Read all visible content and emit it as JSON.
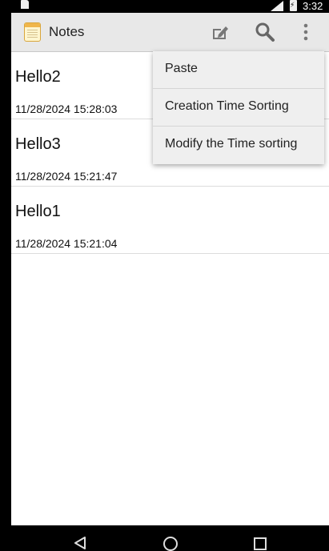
{
  "status_bar": {
    "time": "3:32"
  },
  "action_bar": {
    "title": "Notes",
    "icons": [
      "notepad-app-icon",
      "new-note-icon",
      "search-icon",
      "overflow-menu-icon"
    ]
  },
  "notes": [
    {
      "title": "Hello2",
      "time": "11/28/2024 15:28:03"
    },
    {
      "title": "Hello3",
      "time": "11/28/2024 15:21:47"
    },
    {
      "title": "Hello1",
      "time": "11/28/2024 15:21:04"
    }
  ],
  "menu": {
    "items": [
      {
        "label": "Paste"
      },
      {
        "label": "Creation Time Sorting"
      },
      {
        "label": "Modify the Time sorting"
      }
    ]
  },
  "navigation": {
    "icons": [
      "back-icon",
      "home-icon",
      "recent-apps-icon"
    ]
  },
  "colors": {
    "action_bar": "#e8e8e8",
    "menu_bg": "#efefef",
    "background": "#ffffff"
  }
}
